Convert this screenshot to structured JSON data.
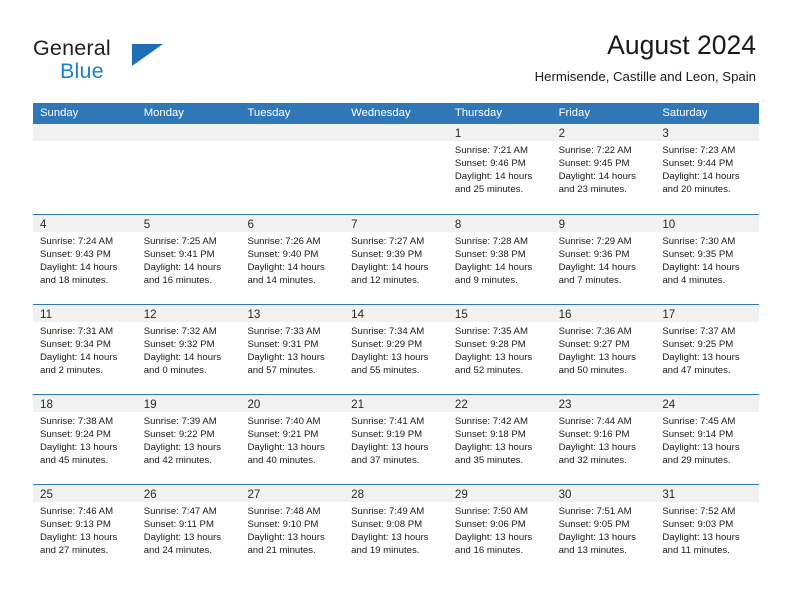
{
  "brand": {
    "line1": "General",
    "line2": "Blue",
    "accent_color": "#1f6eb5",
    "text_color": "#231f20"
  },
  "header": {
    "title": "August 2024",
    "subtitle": "Hermisende, Castille and Leon, Spain"
  },
  "theme": {
    "header_row_bg": "#3077b8",
    "daynum_band_bg": "#f1f1f1",
    "grid_line": "#3077b8",
    "page_bg": "#ffffff"
  },
  "weekdays": [
    "Sunday",
    "Monday",
    "Tuesday",
    "Wednesday",
    "Thursday",
    "Friday",
    "Saturday"
  ],
  "weeks": [
    [
      {
        "day": "",
        "lines": []
      },
      {
        "day": "",
        "lines": []
      },
      {
        "day": "",
        "lines": []
      },
      {
        "day": "",
        "lines": []
      },
      {
        "day": "1",
        "lines": [
          "Sunrise: 7:21 AM",
          "Sunset: 9:46 PM",
          "Daylight: 14 hours",
          "and 25 minutes."
        ]
      },
      {
        "day": "2",
        "lines": [
          "Sunrise: 7:22 AM",
          "Sunset: 9:45 PM",
          "Daylight: 14 hours",
          "and 23 minutes."
        ]
      },
      {
        "day": "3",
        "lines": [
          "Sunrise: 7:23 AM",
          "Sunset: 9:44 PM",
          "Daylight: 14 hours",
          "and 20 minutes."
        ]
      }
    ],
    [
      {
        "day": "4",
        "lines": [
          "Sunrise: 7:24 AM",
          "Sunset: 9:43 PM",
          "Daylight: 14 hours",
          "and 18 minutes."
        ]
      },
      {
        "day": "5",
        "lines": [
          "Sunrise: 7:25 AM",
          "Sunset: 9:41 PM",
          "Daylight: 14 hours",
          "and 16 minutes."
        ]
      },
      {
        "day": "6",
        "lines": [
          "Sunrise: 7:26 AM",
          "Sunset: 9:40 PM",
          "Daylight: 14 hours",
          "and 14 minutes."
        ]
      },
      {
        "day": "7",
        "lines": [
          "Sunrise: 7:27 AM",
          "Sunset: 9:39 PM",
          "Daylight: 14 hours",
          "and 12 minutes."
        ]
      },
      {
        "day": "8",
        "lines": [
          "Sunrise: 7:28 AM",
          "Sunset: 9:38 PM",
          "Daylight: 14 hours",
          "and 9 minutes."
        ]
      },
      {
        "day": "9",
        "lines": [
          "Sunrise: 7:29 AM",
          "Sunset: 9:36 PM",
          "Daylight: 14 hours",
          "and 7 minutes."
        ]
      },
      {
        "day": "10",
        "lines": [
          "Sunrise: 7:30 AM",
          "Sunset: 9:35 PM",
          "Daylight: 14 hours",
          "and 4 minutes."
        ]
      }
    ],
    [
      {
        "day": "11",
        "lines": [
          "Sunrise: 7:31 AM",
          "Sunset: 9:34 PM",
          "Daylight: 14 hours",
          "and 2 minutes."
        ]
      },
      {
        "day": "12",
        "lines": [
          "Sunrise: 7:32 AM",
          "Sunset: 9:32 PM",
          "Daylight: 14 hours",
          "and 0 minutes."
        ]
      },
      {
        "day": "13",
        "lines": [
          "Sunrise: 7:33 AM",
          "Sunset: 9:31 PM",
          "Daylight: 13 hours",
          "and 57 minutes."
        ]
      },
      {
        "day": "14",
        "lines": [
          "Sunrise: 7:34 AM",
          "Sunset: 9:29 PM",
          "Daylight: 13 hours",
          "and 55 minutes."
        ]
      },
      {
        "day": "15",
        "lines": [
          "Sunrise: 7:35 AM",
          "Sunset: 9:28 PM",
          "Daylight: 13 hours",
          "and 52 minutes."
        ]
      },
      {
        "day": "16",
        "lines": [
          "Sunrise: 7:36 AM",
          "Sunset: 9:27 PM",
          "Daylight: 13 hours",
          "and 50 minutes."
        ]
      },
      {
        "day": "17",
        "lines": [
          "Sunrise: 7:37 AM",
          "Sunset: 9:25 PM",
          "Daylight: 13 hours",
          "and 47 minutes."
        ]
      }
    ],
    [
      {
        "day": "18",
        "lines": [
          "Sunrise: 7:38 AM",
          "Sunset: 9:24 PM",
          "Daylight: 13 hours",
          "and 45 minutes."
        ]
      },
      {
        "day": "19",
        "lines": [
          "Sunrise: 7:39 AM",
          "Sunset: 9:22 PM",
          "Daylight: 13 hours",
          "and 42 minutes."
        ]
      },
      {
        "day": "20",
        "lines": [
          "Sunrise: 7:40 AM",
          "Sunset: 9:21 PM",
          "Daylight: 13 hours",
          "and 40 minutes."
        ]
      },
      {
        "day": "21",
        "lines": [
          "Sunrise: 7:41 AM",
          "Sunset: 9:19 PM",
          "Daylight: 13 hours",
          "and 37 minutes."
        ]
      },
      {
        "day": "22",
        "lines": [
          "Sunrise: 7:42 AM",
          "Sunset: 9:18 PM",
          "Daylight: 13 hours",
          "and 35 minutes."
        ]
      },
      {
        "day": "23",
        "lines": [
          "Sunrise: 7:44 AM",
          "Sunset: 9:16 PM",
          "Daylight: 13 hours",
          "and 32 minutes."
        ]
      },
      {
        "day": "24",
        "lines": [
          "Sunrise: 7:45 AM",
          "Sunset: 9:14 PM",
          "Daylight: 13 hours",
          "and 29 minutes."
        ]
      }
    ],
    [
      {
        "day": "25",
        "lines": [
          "Sunrise: 7:46 AM",
          "Sunset: 9:13 PM",
          "Daylight: 13 hours",
          "and 27 minutes."
        ]
      },
      {
        "day": "26",
        "lines": [
          "Sunrise: 7:47 AM",
          "Sunset: 9:11 PM",
          "Daylight: 13 hours",
          "and 24 minutes."
        ]
      },
      {
        "day": "27",
        "lines": [
          "Sunrise: 7:48 AM",
          "Sunset: 9:10 PM",
          "Daylight: 13 hours",
          "and 21 minutes."
        ]
      },
      {
        "day": "28",
        "lines": [
          "Sunrise: 7:49 AM",
          "Sunset: 9:08 PM",
          "Daylight: 13 hours",
          "and 19 minutes."
        ]
      },
      {
        "day": "29",
        "lines": [
          "Sunrise: 7:50 AM",
          "Sunset: 9:06 PM",
          "Daylight: 13 hours",
          "and 16 minutes."
        ]
      },
      {
        "day": "30",
        "lines": [
          "Sunrise: 7:51 AM",
          "Sunset: 9:05 PM",
          "Daylight: 13 hours",
          "and 13 minutes."
        ]
      },
      {
        "day": "31",
        "lines": [
          "Sunrise: 7:52 AM",
          "Sunset: 9:03 PM",
          "Daylight: 13 hours",
          "and 11 minutes."
        ]
      }
    ]
  ]
}
